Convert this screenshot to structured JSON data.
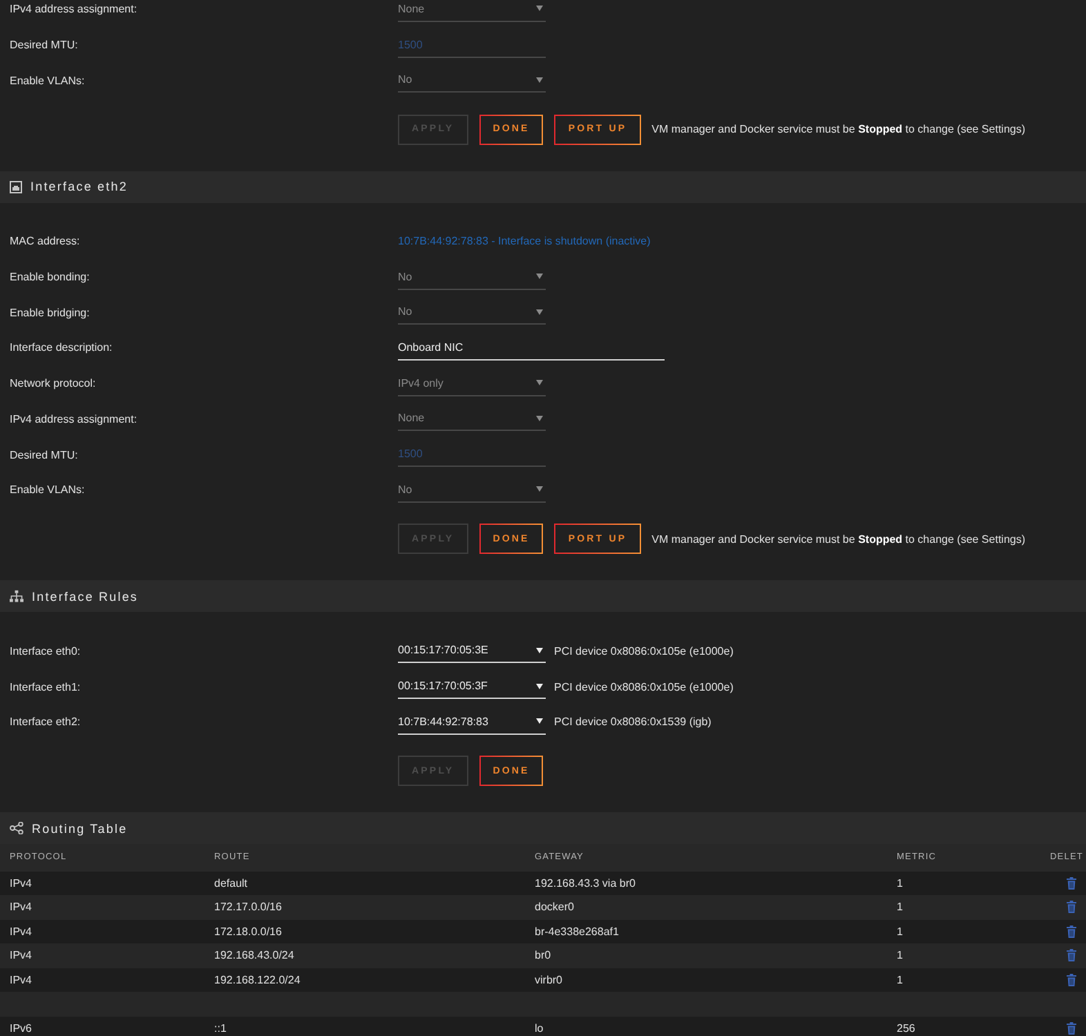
{
  "sections": [
    {
      "kind": "interface",
      "fields": [
        {
          "kind": "select",
          "label": "IPv4 address assignment:",
          "value": "None",
          "disabled": true
        },
        {
          "kind": "number",
          "label": "Desired MTU:",
          "placeholder": "1500",
          "disabled": true
        },
        {
          "kind": "select",
          "label": "Enable VLANs:",
          "value": "No",
          "disabled": true
        }
      ],
      "buttons": [
        {
          "label": "APPLY",
          "disabled": true
        },
        {
          "label": "DONE",
          "disabled": false
        },
        {
          "label": "PORT UP",
          "disabled": false
        }
      ],
      "note": "VM manager and Docker service must be **Stopped** to change (see Settings)"
    },
    {
      "kind": "interface",
      "title": "Interface eth2",
      "fields": [
        {
          "kind": "info",
          "label": "MAC address:",
          "value": "10:7B:44:92:78:83 - Interface is shutdown (inactive)"
        },
        {
          "kind": "select",
          "label": "Enable bonding:",
          "value": "No",
          "disabled": true
        },
        {
          "kind": "select",
          "label": "Enable bridging:",
          "value": "No",
          "disabled": true
        },
        {
          "kind": "text",
          "label": "Interface description:",
          "value": "Onboard NIC",
          "disabled": false
        },
        {
          "kind": "select",
          "label": "Network protocol:",
          "value": "IPv4 only",
          "disabled": true
        },
        {
          "kind": "select",
          "label": "IPv4 address assignment:",
          "value": "None",
          "disabled": true
        },
        {
          "kind": "number",
          "label": "Desired MTU:",
          "placeholder": "1500",
          "disabled": true
        },
        {
          "kind": "select",
          "label": "Enable VLANs:",
          "value": "No",
          "disabled": true
        }
      ],
      "buttons": [
        {
          "label": "APPLY",
          "disabled": true
        },
        {
          "label": "DONE",
          "disabled": false
        },
        {
          "label": "PORT UP",
          "disabled": false
        }
      ],
      "note": "VM manager and Docker service must be **Stopped** to change (see Settings)"
    },
    {
      "kind": "rules",
      "title": "Interface Rules",
      "rules": [
        {
          "label": "Interface eth0:",
          "value": "00:15:17:70:05:3E",
          "disabled": false,
          "device": "PCI device 0x8086:0x105e (e1000e)"
        },
        {
          "label": "Interface eth1:",
          "value": "00:15:17:70:05:3F",
          "disabled": false,
          "device": "PCI device 0x8086:0x105e (e1000e)"
        },
        {
          "label": "Interface eth2:",
          "value": "10:7B:44:92:78:83",
          "disabled": false,
          "device": "PCI device 0x8086:0x1539 (igb)"
        }
      ],
      "buttons": [
        {
          "label": "APPLY",
          "disabled": true
        },
        {
          "label": "DONE",
          "disabled": false
        }
      ]
    },
    {
      "kind": "table",
      "title": "Routing Table",
      "columns": [
        "PROTOCOL",
        "ROUTE",
        "GATEWAY",
        "METRIC",
        "DELET"
      ],
      "rows": [
        {
          "kind": "route",
          "protocol": "IPv4",
          "route": "default",
          "gateway": "192.168.43.3 via br0",
          "metric": "1"
        },
        {
          "kind": "route",
          "protocol": "IPv4",
          "route": "172.17.0.0/16",
          "gateway": "docker0",
          "metric": "1"
        },
        {
          "kind": "route",
          "protocol": "IPv4",
          "route": "172.18.0.0/16",
          "gateway": "br-4e338e268af1",
          "metric": "1"
        },
        {
          "kind": "route",
          "protocol": "IPv4",
          "route": "192.168.43.0/24",
          "gateway": "br0",
          "metric": "1"
        },
        {
          "kind": "route",
          "protocol": "IPv4",
          "route": "192.168.122.0/24",
          "gateway": "virbr0",
          "metric": "1"
        },
        {
          "kind": "gap"
        },
        {
          "kind": "route",
          "protocol": "IPv6",
          "route": "::1",
          "gateway": "lo",
          "metric": "256"
        }
      ]
    }
  ]
}
